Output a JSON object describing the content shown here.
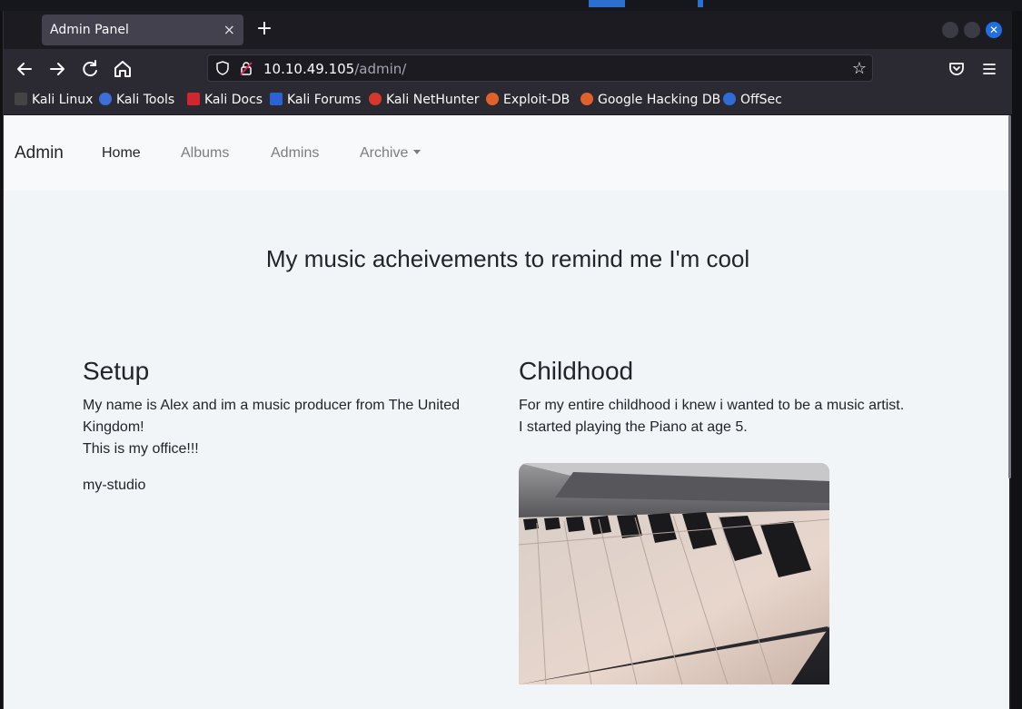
{
  "browser": {
    "tab_title": "Admin Panel",
    "tab_close": "×",
    "new_tab": "+",
    "url_host": "10.10.49.105",
    "url_path": "/admin/",
    "bookmarks": [
      {
        "label": "Kali Linux",
        "icon": "kali-dragon-icon",
        "color": "#444444"
      },
      {
        "label": "Kali Tools",
        "icon": "kali-tools-icon",
        "color": "#3d6ed9"
      },
      {
        "label": "Kali Docs",
        "icon": "kali-docs-icon",
        "color": "#d0262f"
      },
      {
        "label": "Kali Forums",
        "icon": "kali-forums-icon",
        "color": "#2b63d6"
      },
      {
        "label": "Kali NetHunter",
        "icon": "kali-nethunter-icon",
        "color": "#d33a2c"
      },
      {
        "label": "Exploit-DB",
        "icon": "exploit-db-icon",
        "color": "#e0612a"
      },
      {
        "label": "Google Hacking DB",
        "icon": "ghdb-icon",
        "color": "#e0612a"
      },
      {
        "label": "OffSec",
        "icon": "offsec-icon",
        "color": "#2f6cd8"
      }
    ]
  },
  "site": {
    "brand": "Admin",
    "nav": [
      {
        "label": "Home",
        "active": true
      },
      {
        "label": "Albums",
        "active": false
      },
      {
        "label": "Admins",
        "active": false
      },
      {
        "label": "Archive",
        "active": false,
        "dropdown": true
      }
    ],
    "headline": "My music acheivements to remind me I'm cool",
    "setup": {
      "title": "Setup",
      "text1": "My name is Alex and im a music producer from The United Kingdom!",
      "text2": "This is my office!!!",
      "caption": "my-studio"
    },
    "childhood": {
      "title": "Childhood",
      "text1": "For my entire childhood i knew i wanted to be a music artist.",
      "text2": "I started playing the Piano at age 5."
    }
  }
}
